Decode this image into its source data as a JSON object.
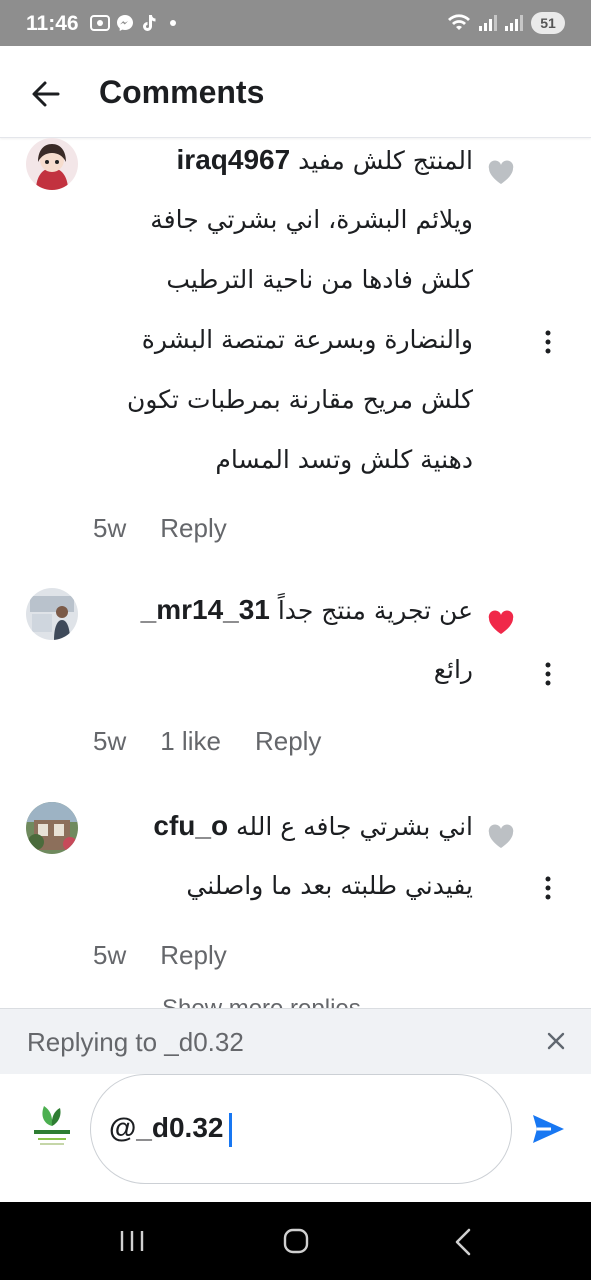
{
  "status_bar": {
    "time": "11:46",
    "battery": "51",
    "notification_icons": [
      "screenshot-icon",
      "messenger-icon",
      "tiktok-icon"
    ]
  },
  "header": {
    "title": "Comments"
  },
  "comments": [
    {
      "username": "iraq4967",
      "lines": [
        "المنتج كلش مفيد",
        "ويلائم البشرة، اني بشرتي جافة",
        "كلش فادها من ناحية الترطيب",
        "والنضارة وبسرعة تمتصة البشرة",
        "كلش مريح مقارنة بمرطبات تكون",
        "دهنية كلش وتسد المسام"
      ],
      "time": "5w",
      "likes": "",
      "reply_label": "Reply",
      "liked": false
    },
    {
      "username": "_mr14_31",
      "lines": [
        "عن تجرية منتج جداً",
        "رائع"
      ],
      "time": "5w",
      "likes": "1 like",
      "reply_label": "Reply",
      "liked": true
    },
    {
      "username": "cfu_o",
      "lines": [
        "اني بشرتي جافه ع الله",
        "يفيدني طلبته بعد ما واصلني"
      ],
      "time": "5w",
      "likes": "",
      "reply_label": "Reply",
      "liked": false
    }
  ],
  "show_more_label": "Show more replies",
  "reply_bar": {
    "text": "Replying to _d0.32"
  },
  "composer": {
    "value": "@_d0.32"
  },
  "colors": {
    "accent": "#1877f2",
    "liked": "#f02849",
    "unliked": "#bcc0c4",
    "muted_text": "#65676b"
  }
}
